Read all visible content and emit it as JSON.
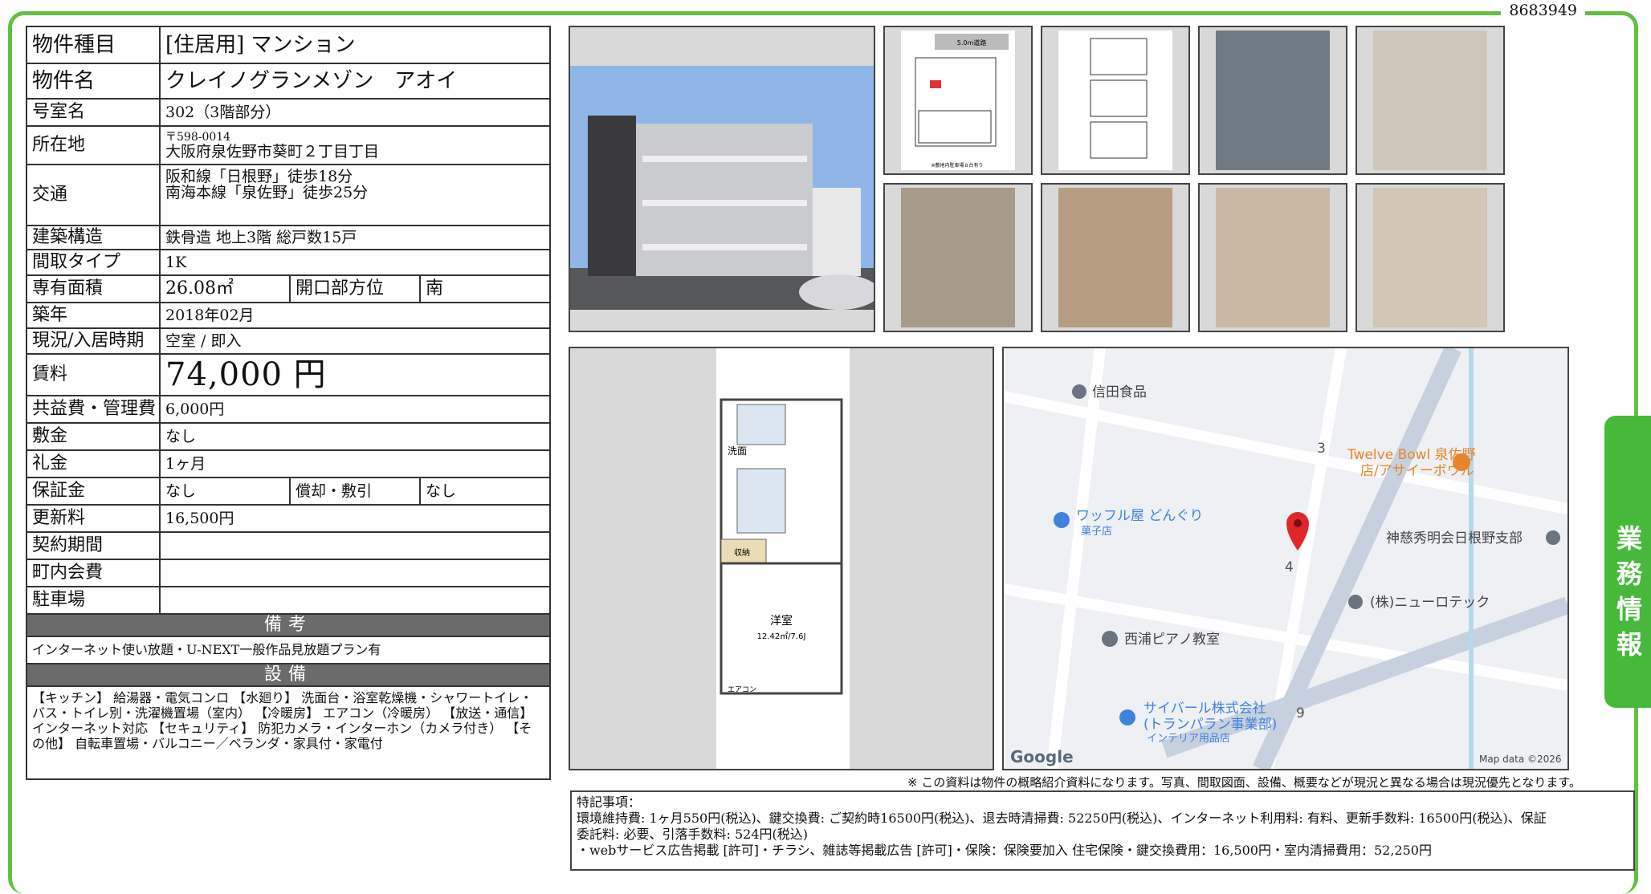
{
  "doc_id": "8683949",
  "fields": {
    "type_label": "物件種目",
    "type_value": "[住居用] マンション",
    "name_label": "物件名",
    "name_value": "クレイノグランメゾン　アオイ",
    "room_label": "号室名",
    "room_value": "302（3階部分）",
    "address_label": "所在地",
    "postal": "〒598-0014",
    "address": "大阪府泉佐野市葵町２丁目丁目",
    "transit_label": "交通",
    "transit_1": "阪和線「日根野」徒歩18分",
    "transit_2": "南海本線「泉佐野」徒歩25分",
    "structure_label": "建築構造",
    "structure_value": "鉄骨造 地上3階 総戸数15戸",
    "layout_label": "間取タイプ",
    "layout_value": "1K",
    "area_label": "専有面積",
    "area_value": "26.08㎡",
    "direction_label": "開口部方位",
    "direction_value": "南",
    "built_label": "築年",
    "built_value": "2018年02月",
    "status_label": "現況/入居時期",
    "status_value": "空室 / 即入",
    "rent_label": "賃料",
    "rent_value": "74,000 円",
    "fee_label": "共益費・管理費",
    "fee_value": "6,000円",
    "deposit_label": "敷金",
    "deposit_value": "なし",
    "key_money_label": "礼金",
    "key_money_value": "1ヶ月",
    "guarantee_label": "保証金",
    "guarantee_value": "なし",
    "amort_label": "償却・敷引",
    "amort_value": "なし",
    "renewal_label": "更新料",
    "renewal_value": "16,500円",
    "contract_label": "契約期間",
    "contract_value": "",
    "town_label": "町内会費",
    "town_value": "",
    "parking_label": "駐車場",
    "parking_value": ""
  },
  "remarks": {
    "header": "備考",
    "text": "インターネット使い放題・U-NEXT一般作品見放題プラン有"
  },
  "facilities": {
    "header": "設備",
    "text": "【キッチン】 給湯器・電気コンロ 【水廻り】 洗面台・浴室乾燥機・シャワートイレ・バス・トイレ別・洗濯機置場（室内） 【冷暖房】 エアコン（冷暖房） 【放送・通信】 インターネット対応 【セキュリティ】 防犯カメラ・インターホン（カメラ付き） 【その他】 自転車置場・バルコニー／ベランダ・家具付・家電付"
  },
  "site_plan": {
    "road": "5.0m道路",
    "footer": "※敷地内駐車場８台有り"
  },
  "floor_plan": {
    "toilet": "洗面",
    "closet": "収納",
    "room": "洋室",
    "room_size": "12.42㎡/7.6J",
    "ac": "エアコン"
  },
  "map": {
    "places": [
      "信田食品",
      "Twelve Bowl 泉佐野",
      "店/アサイーボウル",
      "ワッフル屋 どんぐり",
      "菓子店",
      "神慈秀明会日根野支部",
      "(株)ニューロテック",
      "西浦ピアノ教室",
      "サイバール株式会社",
      "(トランパラン事業部)",
      "インテリア用品店"
    ],
    "numbers": [
      "3",
      "4",
      "9"
    ],
    "google": "Google",
    "attribution": "Map data ©2026"
  },
  "disclaimer": "※ この資料は物件の概略紹介資料になります。写真、間取図面、設備、概要などが現況と異なる場合は現況優先となります。",
  "special": {
    "title": "特記事項：",
    "line1": "環境維持費: 1ヶ月550円(税込)、鍵交換費: ご契約時16500円(税込)、退去時清掃費: 52250円(税込)、インターネット利用料: 有料、更新手数料: 16500円(税込)、保証",
    "line2": "委託料: 必要、引落手数料: 524円(税込)",
    "line3": "・webサービス広告掲載 [許可]・チラシ、雑誌等掲載広告 [許可]・保険：保険要加入 住宅保険・鍵交換費用：16,500円・室内清掃費用：52,250円"
  },
  "side_tab": "業務情報",
  "colors": {
    "frame": "#5fc13e",
    "tab": "#46b93a",
    "header": "#6b6b6b",
    "pin": "#e0262b",
    "poi_orange": "#e8852a",
    "poi_blue": "#3f82e0"
  }
}
